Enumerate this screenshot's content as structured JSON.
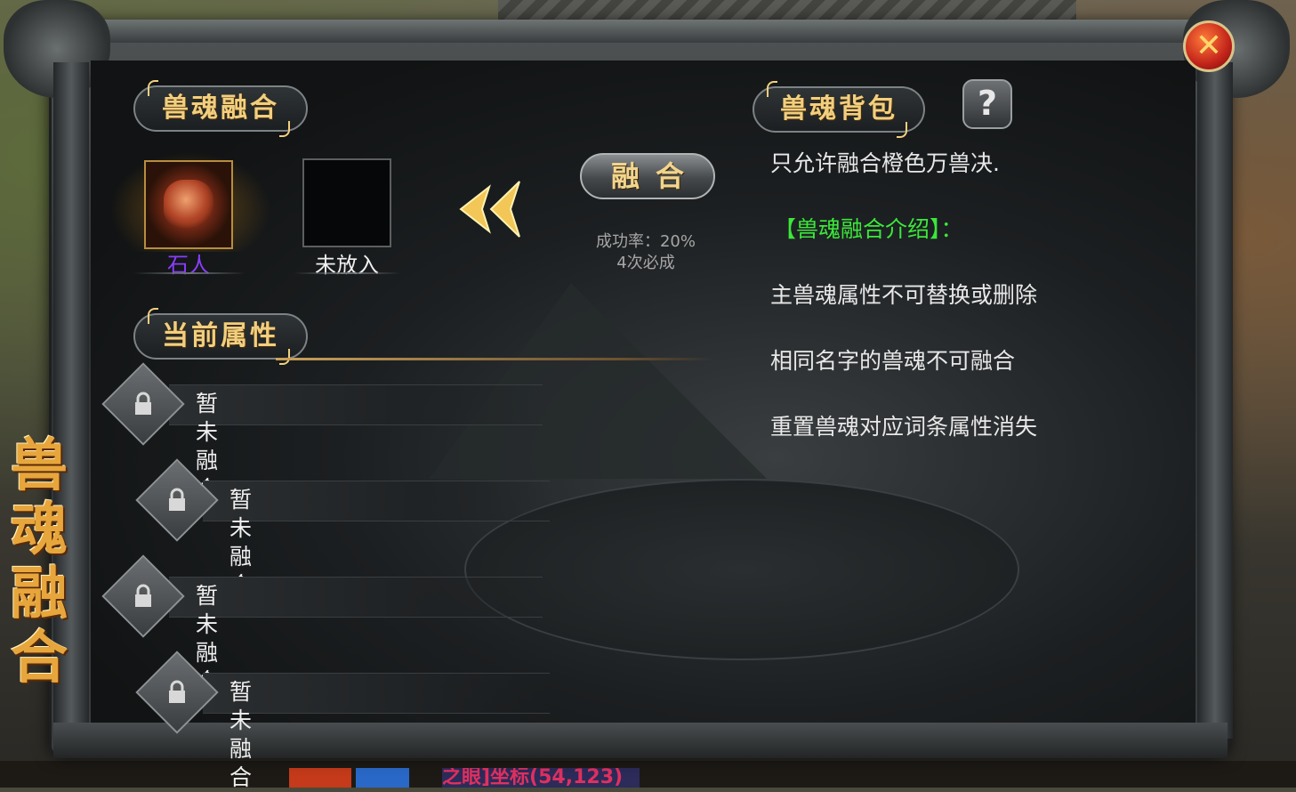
{
  "window": {
    "side_title": [
      "兽",
      "魂",
      "融",
      "合"
    ],
    "close_label": "✕"
  },
  "hud": {
    "bottom_text": "之眼]坐标(54,123)"
  },
  "fusion": {
    "header": "兽魂融合",
    "main_slot_label": "石人",
    "main_slot_label_color": "#8a3dff",
    "second_slot_label": "未放入",
    "fuse_button": "融合",
    "success_rate": "成功率：20%",
    "attempts": "4次必成"
  },
  "attributes": {
    "header": "当前属性",
    "rows": [
      {
        "label": "暂未融合"
      },
      {
        "label": "暂未融合"
      },
      {
        "label": "暂未融合"
      },
      {
        "label": "暂未融合"
      }
    ]
  },
  "bag": {
    "header": "兽魂背包",
    "help_label": "?",
    "notice": "只允许融合橙色万兽决.",
    "intro_title": "【兽魂融合介绍】：",
    "intro_color": "#3be83a",
    "rules": [
      "主兽魂属性不可替换或删除",
      "相同名字的兽魂不可融合",
      "重置兽魂对应词条属性消失"
    ]
  }
}
